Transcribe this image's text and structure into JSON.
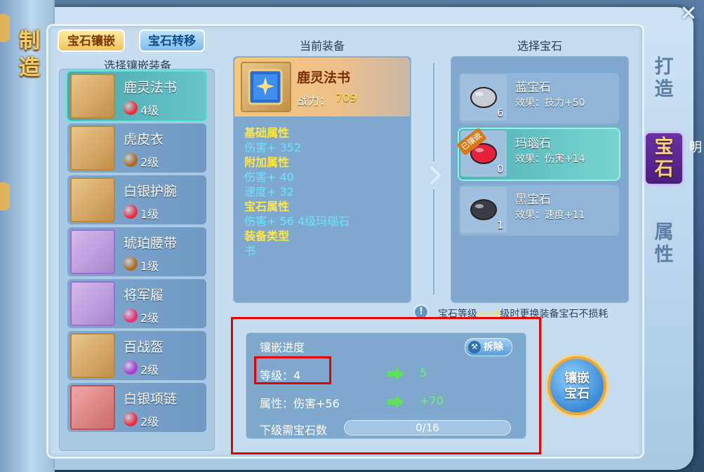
{
  "window": {
    "close_label": "✕"
  },
  "side": {
    "title": "制造"
  },
  "tabs": [
    {
      "label": "宝石镶嵌",
      "active": true
    },
    {
      "label": "宝石转移",
      "active": false
    }
  ],
  "columns": {
    "equip_list": "选择镶嵌装备",
    "current": "当前装备",
    "gems": "选择宝石"
  },
  "equipment": [
    {
      "name": "鹿灵法书",
      "level": "4级",
      "gem_color": "#e8303c",
      "frame": "gold",
      "selected": true
    },
    {
      "name": "虎皮衣",
      "level": "2级",
      "gem_color": "#b06a1e",
      "frame": "gold",
      "selected": false
    },
    {
      "name": "白银护腕",
      "level": "1级",
      "gem_color": "#e8303c",
      "frame": "gold",
      "selected": false
    },
    {
      "name": "琥珀腰带",
      "level": "1级",
      "gem_color": "#b06a1e",
      "frame": "purple",
      "selected": false
    },
    {
      "name": "将军履",
      "level": "2级",
      "gem_color": "#e8306a",
      "frame": "purple",
      "selected": false
    },
    {
      "name": "百战盔",
      "level": "2级",
      "gem_color": "#b03ad0",
      "frame": "gold",
      "selected": false
    },
    {
      "name": "白银项链",
      "level": "2级",
      "gem_color": "#e8303c",
      "frame": "red",
      "selected": false
    }
  ],
  "current_equip": {
    "name": "鹿灵法书",
    "power_label": "战力：",
    "power_value": "709",
    "attrs": [
      {
        "text": "基础属性",
        "style": "y"
      },
      {
        "text": "伤害+ 352",
        "style": "c"
      },
      {
        "text": "附加属性",
        "style": "y"
      },
      {
        "text": "伤害+ 40",
        "style": "c"
      },
      {
        "text": "速度+ 32",
        "style": "c"
      },
      {
        "text": "宝石属性",
        "style": "y"
      },
      {
        "text": "伤害+ 56    4级玛瑙石",
        "style": "c"
      },
      {
        "text": "装备类型",
        "style": "y"
      },
      {
        "text": "书",
        "style": "c"
      }
    ]
  },
  "gems": [
    {
      "name": "蓝宝石",
      "effect": "效果：技力+50",
      "count": "6",
      "color": "#c8ccd2",
      "selected": false
    },
    {
      "name": "玛瑙石",
      "effect": "效果：伤害+14",
      "count": "0",
      "color": "#e8203a",
      "selected": true,
      "badge": "已镶嵌"
    },
    {
      "name": "黑宝石",
      "effect": "效果：速度+11",
      "count": "1",
      "color": "#3a3e44",
      "selected": false
    }
  ],
  "warning": {
    "prefix": "宝石等级",
    "highlight": "<=6",
    "suffix": "级时更换装备宝石不损耗",
    "icon": "!"
  },
  "progress": {
    "title": "镶嵌进度",
    "remove_label": "拆除",
    "level_label": "等级：4",
    "level_next": "5",
    "attr_label": "属性：伤害+56",
    "attr_next": "+70",
    "need_label": "下级需宝石数",
    "need_text": "0/16",
    "need_fraction": 0
  },
  "inlay_button": {
    "line1": "镶嵌",
    "line2": "宝石"
  },
  "right_tabs": [
    {
      "label": "打造",
      "active": false
    },
    {
      "label": "宝石",
      "active": true
    },
    {
      "label": "属性",
      "active": false
    }
  ],
  "side_char": "明"
}
